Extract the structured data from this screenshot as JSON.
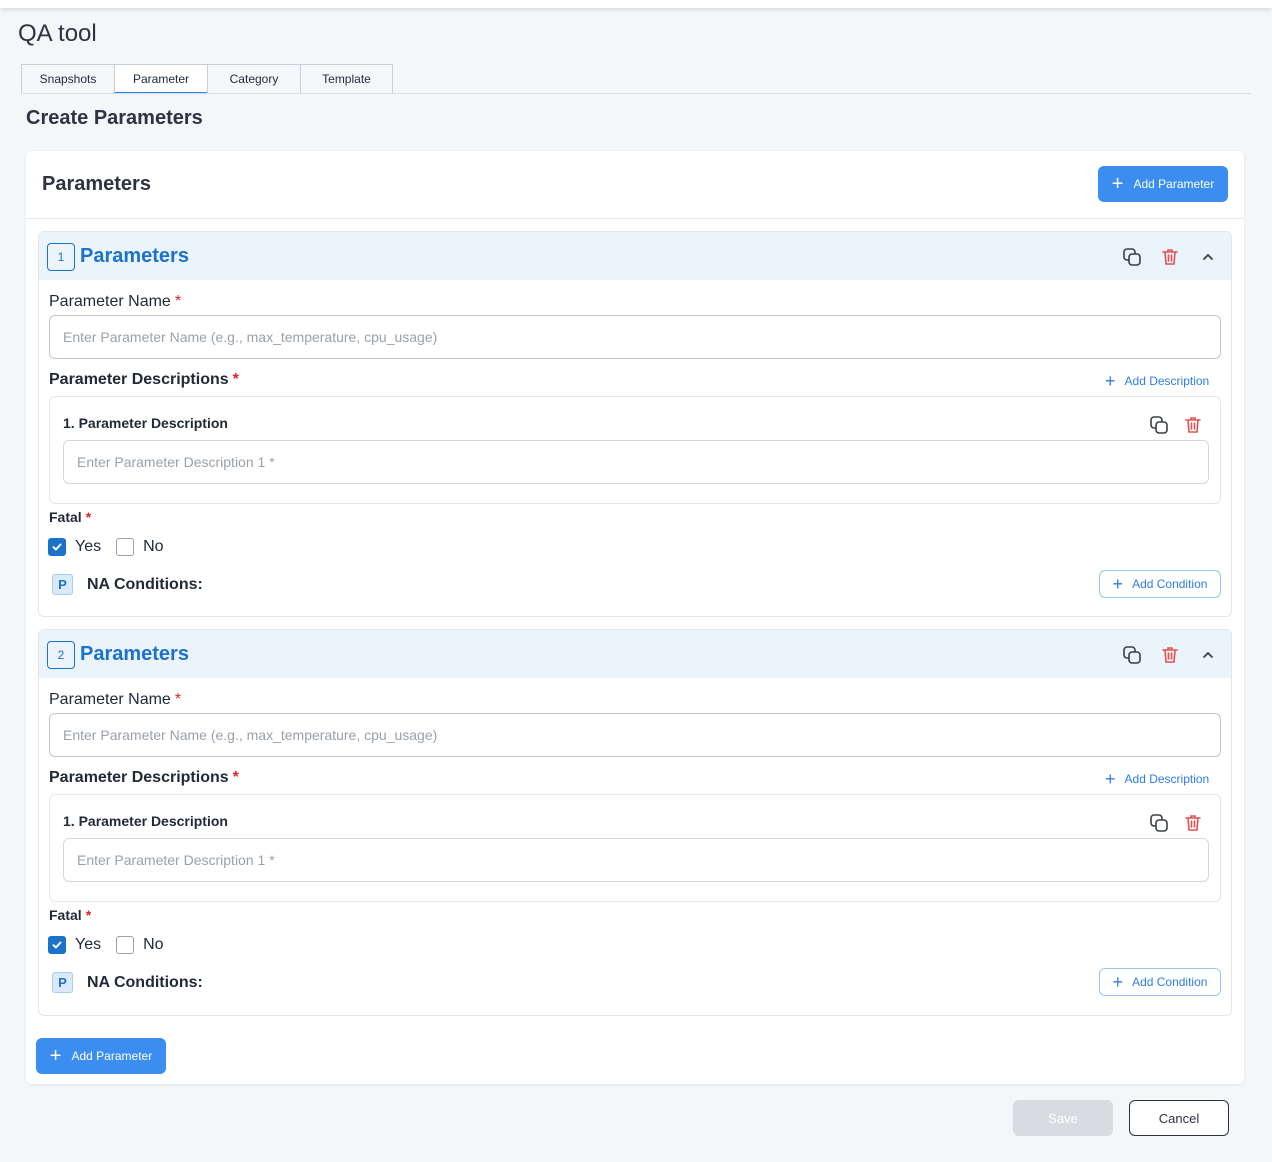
{
  "app": {
    "title": "QA tool"
  },
  "tabs": [
    {
      "label": "Snapshots",
      "active": false
    },
    {
      "label": "Parameter",
      "active": true
    },
    {
      "label": "Category",
      "active": false
    },
    {
      "label": "Template",
      "active": false
    }
  ],
  "page": {
    "title": "Create Parameters"
  },
  "card": {
    "title": "Parameters",
    "add_parameter_label": "Add Parameter"
  },
  "parameters": [
    {
      "index": "1",
      "title": "Parameters",
      "name_label": "Parameter Name",
      "name_required": "*",
      "name_value": "",
      "name_placeholder": "Enter Parameter Name (e.g., max_temperature, cpu_usage)",
      "descriptions_label": "Parameter Descriptions",
      "descriptions_required": "*",
      "add_description_label": "Add Description",
      "descriptions": [
        {
          "label": "1. Parameter Description",
          "value": "",
          "placeholder": "Enter Parameter Description 1 *"
        }
      ],
      "fatal_label": "Fatal",
      "fatal_required": "*",
      "fatal_yes_label": "Yes",
      "fatal_no_label": "No",
      "fatal_yes_checked": true,
      "fatal_no_checked": false,
      "na_label": "NA Conditions:",
      "add_condition_label": "Add Condition"
    },
    {
      "index": "2",
      "title": "Parameters",
      "name_label": "Parameter Name",
      "name_required": "*",
      "name_value": "",
      "name_placeholder": "Enter Parameter Name (e.g., max_temperature, cpu_usage)",
      "descriptions_label": "Parameter Descriptions",
      "descriptions_required": "*",
      "add_description_label": "Add Description",
      "descriptions": [
        {
          "label": "1. Parameter Description",
          "value": "",
          "placeholder": "Enter Parameter Description 1 *"
        }
      ],
      "fatal_label": "Fatal",
      "fatal_required": "*",
      "fatal_yes_label": "Yes",
      "fatal_no_label": "No",
      "fatal_yes_checked": true,
      "fatal_no_checked": false,
      "na_label": "NA Conditions:",
      "add_condition_label": "Add Condition"
    }
  ],
  "footer": {
    "add_parameter_label": "Add Parameter",
    "save_label": "Save",
    "cancel_label": "Cancel"
  },
  "colors": {
    "accent": "#3b8df0",
    "title_blue": "#1a73c8",
    "danger": "#e05252",
    "required": "#e02424"
  },
  "icons": {
    "add": "plus-icon",
    "duplicate": "copy-icon",
    "delete": "trash-icon",
    "collapse": "chevron-up-icon",
    "checked": "check-icon",
    "na": "flag-p-icon"
  }
}
